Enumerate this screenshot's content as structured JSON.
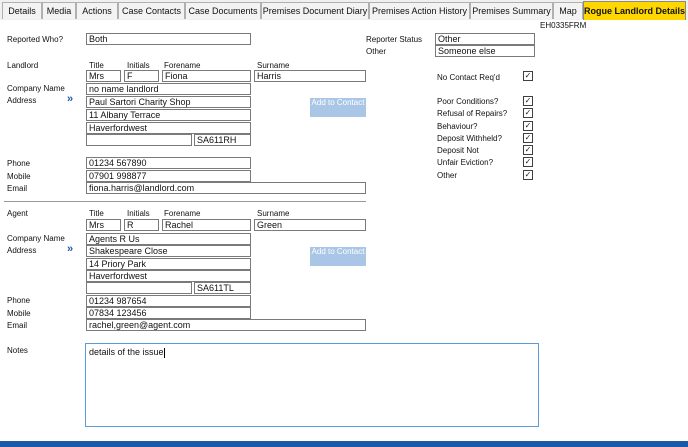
{
  "tabs": [
    {
      "label": "Details",
      "active": false
    },
    {
      "label": "Media",
      "active": false
    },
    {
      "label": "Actions",
      "active": false
    },
    {
      "label": "Case Contacts",
      "active": false
    },
    {
      "label": "Case Documents",
      "active": false
    },
    {
      "label": "Premises Document Diary",
      "active": false
    },
    {
      "label": "Premises Action History",
      "active": false
    },
    {
      "label": "Premises Summary",
      "active": false
    },
    {
      "label": "Map",
      "active": false
    },
    {
      "label": "Rogue Landlord Details",
      "active": true
    }
  ],
  "form_id": "EH0335FRM",
  "reported_who": {
    "label": "Reported Who?",
    "value": "Both"
  },
  "reporter_status": {
    "label": "Reporter Status",
    "value": "Other"
  },
  "other": {
    "label": "Other",
    "value": "Someone else"
  },
  "landlord": {
    "section_label": "Landlord",
    "col_title": "Title",
    "col_initials": "Initials",
    "col_forename": "Forename",
    "col_surname": "Surname",
    "title": "Mrs",
    "initials": "F",
    "forename": "Fiona",
    "surname": "Harris",
    "company_label": "Company Name",
    "company": "no name landlord",
    "address_label": "Address",
    "address1": "Paul Sartori Charity Shop",
    "address2": "11 Albany Terrace",
    "address3": "Haverfordwest",
    "address4": "",
    "postcode": "SA611RH",
    "add_contact": "Add to Contact",
    "phone_label": "Phone",
    "phone": "01234 567890",
    "mobile_label": "Mobile",
    "mobile": "07901 998877",
    "email_label": "Email",
    "email": "fiona.harris@landlord.com"
  },
  "agent": {
    "section_label": "Agent",
    "col_title": "Title",
    "col_initials": "Initials",
    "col_forename": "Forename",
    "col_surname": "Surname",
    "title": "Mrs",
    "initials": "R",
    "forename": "Rachel",
    "surname": "Green",
    "company_label": "Company Name",
    "company": "Agents R Us",
    "address_label": "Address",
    "address1": "Shakespeare Close",
    "address2": "14 Priory Park",
    "address3": "Haverfordwest",
    "address4": "",
    "postcode": "SA611TL",
    "add_contact": "Add to Contact",
    "phone_label": "Phone",
    "phone": "01234 987654",
    "mobile_label": "Mobile",
    "mobile": "07834 123456",
    "email_label": "Email",
    "email": "rachel,green@agent.com"
  },
  "checks": [
    {
      "label": "No Contact Req'd",
      "checked": true
    },
    {
      "label": "Poor Conditions?",
      "checked": true
    },
    {
      "label": "Refusal of Repairs?",
      "checked": true
    },
    {
      "label": "Behaviour?",
      "checked": true
    },
    {
      "label": "Deposit Withheld?",
      "checked": true
    },
    {
      "label": "Deposit Not",
      "checked": true
    },
    {
      "label": "Unfair Eviction?",
      "checked": true
    },
    {
      "label": "Other",
      "checked": true
    }
  ],
  "notes": {
    "label": "Notes",
    "value": "details of the issue"
  },
  "check_glyph": "✓",
  "arrow_glyph": "»"
}
